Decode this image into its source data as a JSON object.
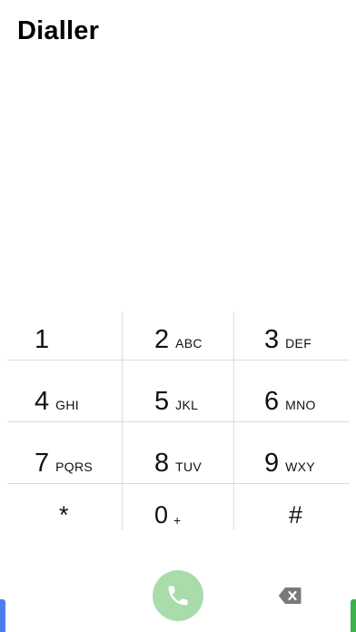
{
  "header": {
    "title": "Dialler"
  },
  "keypad": {
    "keys": [
      {
        "digit": "1",
        "letters": ""
      },
      {
        "digit": "2",
        "letters": "ABC"
      },
      {
        "digit": "3",
        "letters": "DEF"
      },
      {
        "digit": "4",
        "letters": "GHI"
      },
      {
        "digit": "5",
        "letters": "JKL"
      },
      {
        "digit": "6",
        "letters": "MNO"
      },
      {
        "digit": "7",
        "letters": "PQRS"
      },
      {
        "digit": "8",
        "letters": "TUV"
      },
      {
        "digit": "9",
        "letters": "WXY"
      },
      {
        "digit": "*",
        "letters": ""
      },
      {
        "digit": "0",
        "letters": "+"
      },
      {
        "digit": "#",
        "letters": ""
      }
    ]
  },
  "actions": {
    "call_icon": "phone-icon",
    "backspace_icon": "backspace-icon",
    "call_color": "#a8dcaa"
  },
  "colors": {
    "divider": "#dcdcdc",
    "edge_left": "#4d7ef0",
    "edge_right": "#3bb24a"
  }
}
